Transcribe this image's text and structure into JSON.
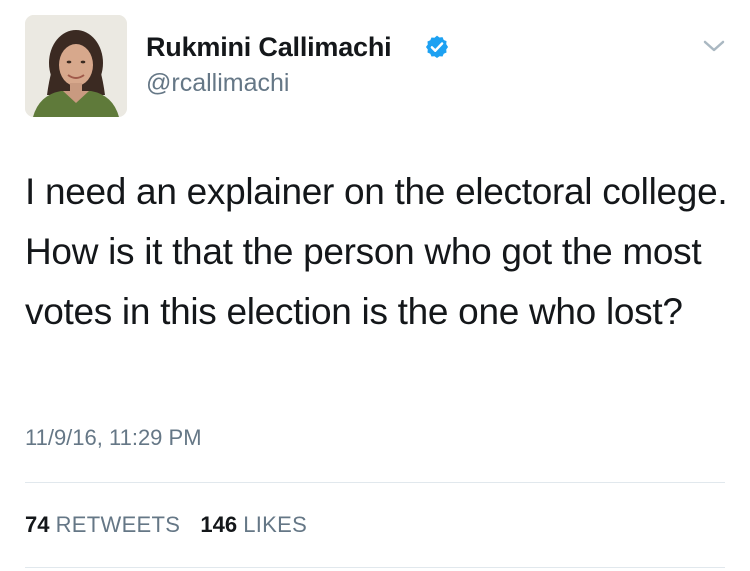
{
  "tweet": {
    "author_name": "Rukmini Callimachi",
    "handle": "@rcallimachi",
    "text": "I need an explainer on the electoral college. How is it that the person who got the most votes in this election is the one who lost?",
    "timestamp": "11/9/16, 11:29 PM",
    "retweets": {
      "count": "74",
      "label": "RETWEETS"
    },
    "likes": {
      "count": "146",
      "label": "LIKES"
    }
  },
  "icons": {
    "verified": "verified-badge-icon",
    "menu": "chevron-down-icon"
  },
  "colors": {
    "text_primary": "#14171a",
    "text_secondary": "#657786",
    "verified_blue": "#1da1f2",
    "divider": "#e1e8ed"
  }
}
